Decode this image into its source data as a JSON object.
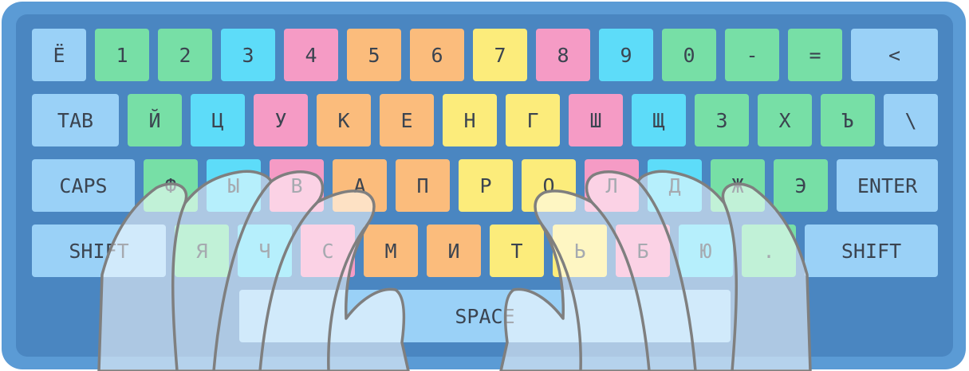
{
  "keyboard": {
    "row1": [
      "Ё",
      "1",
      "2",
      "3",
      "4",
      "5",
      "6",
      "7",
      "8",
      "9",
      "0",
      "-",
      "=",
      "<"
    ],
    "row2": [
      "TAB",
      "Й",
      "Ц",
      "У",
      "К",
      "Е",
      "Н",
      "Г",
      "Ш",
      "Щ",
      "З",
      "Х",
      "Ъ",
      "\\"
    ],
    "row3": [
      "CAPS",
      "Ф",
      "Ы",
      "В",
      "А",
      "П",
      "Р",
      "О",
      "Л",
      "Д",
      "Ж",
      "Э",
      "ENTER"
    ],
    "row4": [
      "SHIFT",
      "Я",
      "Ч",
      "С",
      "М",
      "И",
      "Т",
      "Ь",
      "Б",
      "Ю",
      ".",
      "SHIFT"
    ],
    "space": "SPACE"
  },
  "colors": {
    "frame": "#5b9bd5",
    "panel": "#4a86c1",
    "green": "#77dfa6",
    "cyan": "#5ddcf9",
    "pink": "#f59bc5",
    "orange": "#fbbc7c",
    "yellow": "#fcec7b",
    "light": "#9ad1f7"
  }
}
